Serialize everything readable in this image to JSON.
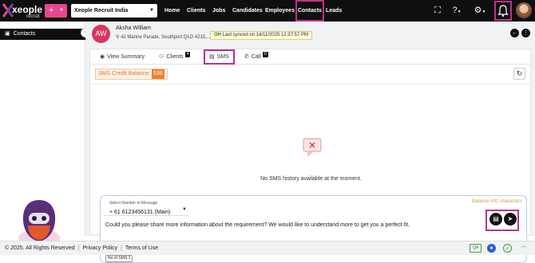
{
  "app": {
    "logo_text": "xeople",
    "logo_sub": "recruit",
    "add_button": "+",
    "org_select": "Xeople Recruit India"
  },
  "nav": {
    "items": [
      {
        "label": "Home"
      },
      {
        "label": "Clients"
      },
      {
        "label": "Jobs"
      },
      {
        "label": "Candidates"
      },
      {
        "label": "Employees"
      },
      {
        "label": "Contacts",
        "active": true
      },
      {
        "label": "Leads"
      }
    ],
    "icons": [
      "fullscreen-icon",
      "help-icon",
      "settings-icon",
      "notification-bell-icon"
    ]
  },
  "sidebar": {
    "items": [
      {
        "label": "Contacts",
        "icon": "contact-card-icon"
      }
    ]
  },
  "contact": {
    "initials": "AW",
    "name": "Aksha William",
    "address": "42 Marine Parade, Southport QLD 4215,...",
    "sync_text": "Last synced on 14/11/2025 12:37:57 PM",
    "sync_badge": "OH"
  },
  "tabs": [
    {
      "label": "View Summary",
      "icon": "eye-icon"
    },
    {
      "label": "Clients",
      "icon": "clients-icon",
      "badge": "4"
    },
    {
      "label": "SMS",
      "icon": "sms-icon",
      "active": true
    },
    {
      "label": "Call",
      "icon": "phone-icon",
      "badge": "0"
    }
  ],
  "sms": {
    "credit_label": "SMS Credit Balance:",
    "credit_value": "538",
    "empty_message": "No SMS history available at the moment.",
    "number_label": "Select Number to Message",
    "number_value": "+ 61 6123456131 (Main)",
    "balance_text": "Balance #91 characters",
    "message": "Could you please share more information about the requirement? We would like to understand more to get you a perfect fit.",
    "sms_count": "No of SMS:1"
  },
  "footer": {
    "copyright": "© 2025. All Rights Reserved",
    "privacy": "Privacy Policy",
    "terms": "Terms of Use",
    "qa_badge": "QA"
  },
  "colors": {
    "accent": "#c0308a",
    "brand_pink": "#e8468e",
    "credit_orange": "#ef7d2a",
    "avatar_red": "#d9385e"
  }
}
